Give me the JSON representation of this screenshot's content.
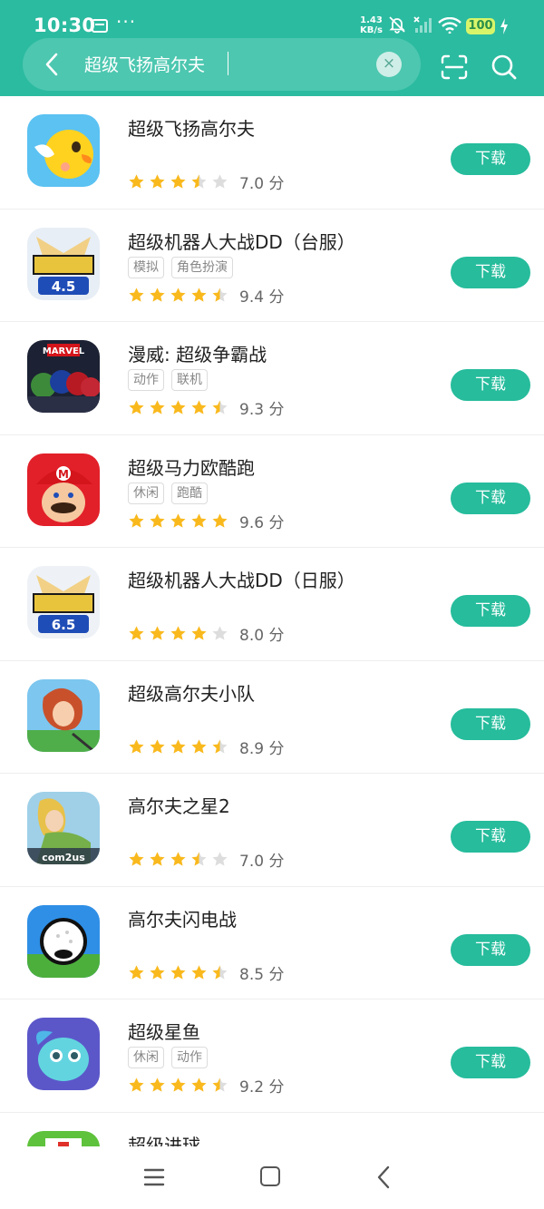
{
  "status_bar": {
    "time": "10:30",
    "more": "···",
    "speed_value": "1.43",
    "speed_unit": "KB/s",
    "battery": "100"
  },
  "search": {
    "query": "超级飞扬高尔夫",
    "clear_symbol": "×"
  },
  "colors": {
    "accent": "#2bbba0",
    "button": "#26bc9c",
    "star": "#f9b91d",
    "star_empty": "#dddddd"
  },
  "apps": [
    {
      "title": "超级飞扬高尔夫",
      "tags": [],
      "stars": 3.5,
      "score": "7.0 分",
      "button": "下载",
      "icon": "yellow-bird-icon"
    },
    {
      "title": "超级机器人大战DD（台服）",
      "tags": [
        "模拟",
        "角色扮演"
      ],
      "stars": 4.5,
      "score": "9.4 分",
      "button": "下载",
      "icon": "robot-wars-dd-icon"
    },
    {
      "title": "漫威: 超级争霸战",
      "tags": [
        "动作",
        "联机"
      ],
      "stars": 4.5,
      "score": "9.3 分",
      "button": "下载",
      "icon": "marvel-heroes-icon"
    },
    {
      "title": "超级马力欧酷跑",
      "tags": [
        "休闲",
        "跑酷"
      ],
      "stars": 5,
      "score": "9.6 分",
      "button": "下载",
      "icon": "mario-icon"
    },
    {
      "title": "超级机器人大战DD（日服）",
      "tags": [],
      "stars": 4,
      "score": "8.0 分",
      "button": "下载",
      "icon": "robot-wars-dd-jp-icon"
    },
    {
      "title": "超级高尔夫小队",
      "tags": [],
      "stars": 4.5,
      "score": "8.9 分",
      "button": "下载",
      "icon": "golf-girl-icon"
    },
    {
      "title": "高尔夫之星2",
      "tags": [],
      "stars": 3.5,
      "score": "7.0 分",
      "button": "下载",
      "icon": "golf-star-icon"
    },
    {
      "title": "高尔夫闪电战",
      "tags": [],
      "stars": 4.5,
      "score": "8.5 分",
      "button": "下载",
      "icon": "golf-ball-icon"
    },
    {
      "title": "超级星鱼",
      "tags": [
        "休闲",
        "动作"
      ],
      "stars": 4.5,
      "score": "9.2 分",
      "button": "下载",
      "icon": "star-fish-icon"
    },
    {
      "title": "超级进球",
      "tags": [],
      "stars": null,
      "score": "",
      "button": "",
      "icon": "goal-icon"
    }
  ]
}
